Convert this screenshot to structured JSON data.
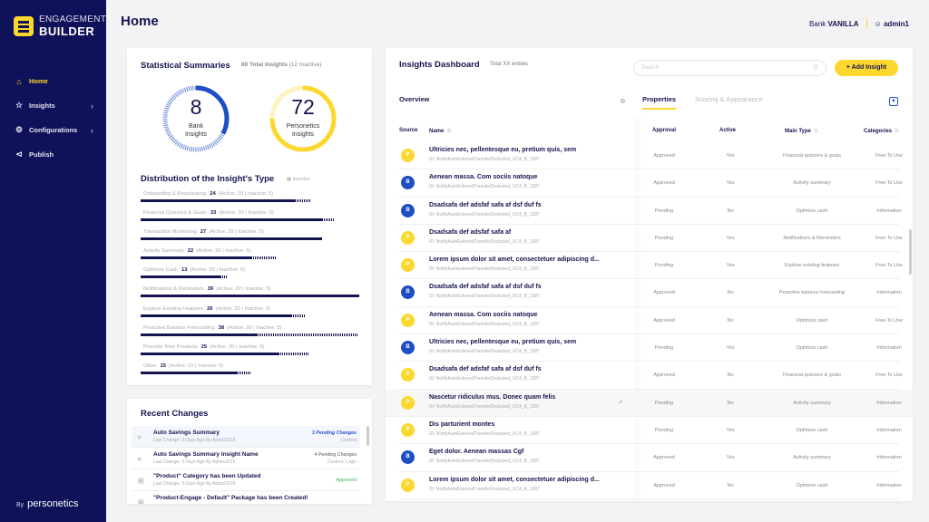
{
  "app": {
    "logo_line1": "ENGAGEMENT",
    "logo_line2": "BUILDER",
    "by_label": "By",
    "by_brand": "personetics"
  },
  "sidebar": {
    "items": [
      {
        "label": "Home",
        "icon": "home-icon",
        "active": true
      },
      {
        "label": "Insights",
        "icon": "star-icon",
        "chevron": true
      },
      {
        "label": "Configurations",
        "icon": "gear-icon",
        "chevron": true
      },
      {
        "label": "Publish",
        "icon": "share-icon"
      }
    ]
  },
  "header": {
    "title": "Home",
    "bank_prefix": "Bank",
    "bank_name": "VANILLA",
    "user": "admin1"
  },
  "stats": {
    "title": "Statistical Summaries",
    "total": "80 Total Insights",
    "inactive": "(12 Inactive)",
    "bank": {
      "value": "8",
      "label1": "Bank",
      "label2": "Insights",
      "solid_fraction": 0.33,
      "color": "#1d4ec4"
    },
    "personetics": {
      "value": "72",
      "label1": "Personetics",
      "label2": "Insights",
      "solid_fraction": 0.75,
      "color": "#fcd82e"
    },
    "dist_title": "Distribution of the Insight's Type",
    "dist_legend": "Inactive",
    "dist": [
      {
        "name": "Onboarding & Reactivating",
        "count": "24",
        "detail": "(Active: 20 | Inactive: 5)",
        "total_pct": 78,
        "active_pct": 71
      },
      {
        "name": "Financial Quizzers & Goals",
        "count": "33",
        "detail": "(Active: 20 | Inactive: 5)",
        "total_pct": 89,
        "active_pct": 83
      },
      {
        "name": "Transaction Monitoring",
        "count": "27",
        "detail": "(Active: 20 | Inactive: 5)",
        "total_pct": 83,
        "active_pct": 83
      },
      {
        "name": "Activity Summary",
        "count": "22",
        "detail": "(Active: 20 | Inactive: 5)",
        "total_pct": 62,
        "active_pct": 51
      },
      {
        "name": "Optimize Cash",
        "count": "13",
        "detail": "(Active: 20 | Inactive: 5)",
        "total_pct": 40,
        "active_pct": 37
      },
      {
        "name": "Notifications & Reminders",
        "count": "39",
        "detail": "(Active: 20 | Inactive: 5)",
        "total_pct": 100,
        "active_pct": 100
      },
      {
        "name": "Explore Existing Features",
        "count": "26",
        "detail": "(Active: 20 | Inactive: 5)",
        "total_pct": 75,
        "active_pct": 69
      },
      {
        "name": "Proactive Balance Forecasting",
        "count": "38",
        "detail": "(Active: 20 | Inactive: 5)",
        "total_pct": 99,
        "active_pct": 53
      },
      {
        "name": "Promote New Products",
        "count": "25",
        "detail": "(Active: 20 | Inactive: 5)",
        "total_pct": 77,
        "active_pct": 63
      },
      {
        "name": "Other",
        "count": "15",
        "detail": "(Active: 20 | Inactive: 5)",
        "total_pct": 50,
        "active_pct": 44
      }
    ]
  },
  "recent": {
    "title": "Recent Changes",
    "items": [
      {
        "name": "Auto Savings Summary",
        "meta": "Last Change: 3 Days Ago By Admin2019",
        "status": "3 Pending Changes",
        "detail": "Content",
        "kind": "blue",
        "icon": "pin-icon"
      },
      {
        "name": "Auto Savings Summary Insight Name",
        "meta": "Last Change: 3 Days Ago By Admin2019",
        "status": "4 Pending Changes",
        "detail": "Content, Logic",
        "kind": "",
        "icon": "pin-icon"
      },
      {
        "name": "\"Product\" Category has been Updated",
        "meta": "Last Change: 3 Days Ago By Admin2019",
        "status": "Approved",
        "detail": "",
        "kind": "green",
        "icon": "card-icon"
      },
      {
        "name": "\"Product-Engage - Default\" Package has been Created!",
        "meta": "",
        "status": "",
        "detail": "",
        "kind": "",
        "icon": "package-icon"
      }
    ]
  },
  "dashboard": {
    "title": "Insights Dashboard",
    "total": "Total XX entries",
    "search_placeholder": "Search",
    "add_label": "+ Add Insight",
    "overview": "Overview",
    "tabs": [
      "Properties",
      "Scoring & Appearance"
    ],
    "columns": {
      "source": "Source",
      "name": "Name",
      "approval": "Approval",
      "active": "Active",
      "main_type": "Main Type",
      "categories": "Categories"
    },
    "rows": [
      {
        "src": "P",
        "name": "Ultricies nec, pellentesque eu, pretium quis, sem",
        "id": "ID: NotifyAutoExternalTransferDeducted_UC4_B_1387",
        "approval": "Approved",
        "active": "Yes",
        "type": "Financial quizzers & goals",
        "cat": "Free To Use"
      },
      {
        "src": "B",
        "name": "Aenean massa. Com sociis natoque",
        "id": "ID: NotifyAutoExternalTransferDeducted_UC4_B_1387",
        "approval": "Approved",
        "active": "Yes",
        "type": "Activity summary",
        "cat": "Free To Use"
      },
      {
        "src": "B",
        "name": "Dsadsafa def adsfaf safa af dsf duf fs",
        "id": "ID: NotifyAutoExternalTransferDeducted_UC4_B_1387",
        "approval": "Pending",
        "active": "No",
        "type": "Optimize cash",
        "cat": "Information"
      },
      {
        "src": "P",
        "name": "Dsadsafa def adsfaf safa af",
        "id": "ID: NotifyAutoExternalTransferDeducted_UC4_B_1387",
        "approval": "Pending",
        "active": "Yes",
        "type": "Notifications & Reminders",
        "cat": "Free To Use"
      },
      {
        "src": "P",
        "name": "Lorem ipsum dolor sit amet, consectetuer adipiscing d...",
        "id": "ID: NotifyAutoExternalTransferDeducted_UC4_B_1387",
        "approval": "Pending",
        "active": "Yes",
        "type": "Explore existing features",
        "cat": "Free To Use"
      },
      {
        "src": "B",
        "name": "Dsadsafa def adsfaf safa af dsf duf fs",
        "id": "ID: NotifyAutoExternalTransferDeducted_UC4_B_1387",
        "approval": "Approved",
        "active": "No",
        "type": "Proactive balance forecasting",
        "cat": "Information"
      },
      {
        "src": "P",
        "name": "Aenean massa. Com sociis natoque",
        "id": "ID: NotifyAutoExternalTransferDeducted_UC4_B_1387",
        "approval": "Approved",
        "active": "No",
        "type": "Optimize cash",
        "cat": "Free To Use"
      },
      {
        "src": "B",
        "name": "Ultricies nec, pellentesque eu, pretium quis, sem",
        "id": "ID: NotifyAutoExternalTransferDeducted_UC4_B_1387",
        "approval": "Pending",
        "active": "Yes",
        "type": "Optimize cash",
        "cat": "Information"
      },
      {
        "src": "P",
        "name": "Dsadsafa def adsfaf safa af dsf duf fs",
        "id": "ID: NotifyAutoExternalTransferDeducted_UC4_B_1387",
        "approval": "Approved",
        "active": "No",
        "type": "Financial quizzers & goals",
        "cat": "Free To Use"
      },
      {
        "src": "P",
        "name": "Nascetur ridiculus mus. Donec quam felis",
        "id": "ID: NotifyAutoExternalTransferDeducted_UC4_B_1387",
        "approval": "Pending",
        "active": "No",
        "type": "Activity summary",
        "cat": "Information",
        "hl": true
      },
      {
        "src": "P",
        "name": "Dis parturient montes",
        "id": "ID: NotifyAutoExternalTransferDeducted_UC4_B_1387",
        "approval": "Pending",
        "active": "Yes",
        "type": "Optimize cash",
        "cat": "Information"
      },
      {
        "src": "B",
        "name": "Eget dolor. Aenean massas Cgf",
        "id": "ID: NotifyAutoExternalTransferDeducted_UC4_B_1387",
        "approval": "Approved",
        "active": "Yes",
        "type": "Activity summary",
        "cat": "Information"
      },
      {
        "src": "P",
        "name": "Lorem ipsum dolor sit amet, consectetuer adipiscing d...",
        "id": "ID: NotifyAutoExternalTransferDeducted_UC4_B_1387",
        "approval": "Approved",
        "active": "No",
        "type": "Optimize cash",
        "cat": "Information"
      }
    ]
  }
}
